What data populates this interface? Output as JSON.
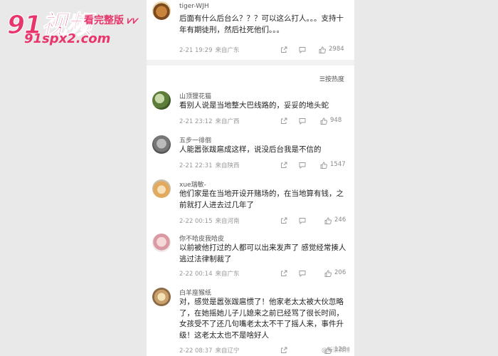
{
  "watermark": {
    "big": "91视频",
    "tag": "看完整版 ⩗⩗",
    "url": "91spx2.com"
  },
  "sort_label": "☰按热度",
  "top_comment": {
    "user": "tiger-WJH",
    "text": "后面有什么后台么？？？可以这么打人。。。支持十年有期徒刑，然后社死他们。。。",
    "date": "2-21 19:29",
    "loc": "来自广东",
    "likes": "2984"
  },
  "comments": [
    {
      "user": "山顶狸花猫",
      "text": "看别人说是当地整大巴线路的，妥妥的地头蛇",
      "date": "2-21 23:12",
      "loc": "来自广西",
      "likes": "948"
    },
    {
      "user": "五步一徘徊",
      "text": "人能嚣张跋扈成这样，说没后台我是不信的",
      "date": "2-21 22:31",
      "loc": "来自陕西",
      "likes": "1547"
    },
    {
      "user": "xue瑞敏-",
      "text": "他们家是在当地开设开赌场的，在当地算有钱，之前就打人进去过几年了",
      "date": "2-22 00:15",
      "loc": "来自河南",
      "likes": "246"
    },
    {
      "user": "你不哈皮我哈皮",
      "text": "以前被他打过的人都可以出来发声了 感觉经常揍人逃过法律制裁了",
      "date": "2-22 00:14",
      "loc": "来自广东",
      "likes": "206"
    },
    {
      "user": "白羊座猴纸",
      "text": "对，感觉是嚣张跋扈惯了！他家老太太被大伙忽略了，在她摇她儿子儿媳来之前已经骂了很长时间，女孩受不了还几句嘴老太太不干了摇人来，事件升级！这老太太也不是啥好人",
      "date": "2-22 08:37",
      "loc": "来自辽宁",
      "likes": "128"
    }
  ],
  "bottom_watermark": "@新浪微博"
}
